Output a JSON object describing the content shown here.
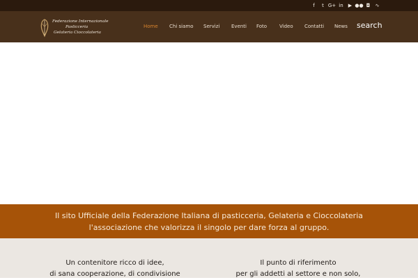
{
  "topbar": {
    "social": [
      {
        "icon": "facebook-icon",
        "glyph": "f"
      },
      {
        "icon": "twitter-icon",
        "glyph": "t"
      },
      {
        "icon": "google-plus-icon",
        "glyph": "G+"
      },
      {
        "icon": "linkedin-icon",
        "glyph": "in"
      },
      {
        "icon": "youtube-icon",
        "glyph": "▶"
      },
      {
        "icon": "flickr-icon",
        "glyph": "●●"
      },
      {
        "icon": "instagram-icon",
        "glyph": "◘"
      },
      {
        "icon": "rss-icon",
        "glyph": "∿"
      }
    ]
  },
  "logo": {
    "line1": "Federazione Internazionale",
    "line2": "Pasticceria",
    "line3": "Gelateria Cioccolateria"
  },
  "nav": {
    "items": [
      {
        "label": "Home"
      },
      {
        "label": "Chi siamo"
      },
      {
        "label": "Servizi"
      },
      {
        "label": "Eventi"
      },
      {
        "label": "Foto"
      },
      {
        "label": "Video"
      },
      {
        "label": "Contatti"
      },
      {
        "label": "News"
      }
    ],
    "search_label": "search"
  },
  "banner": {
    "line1": "Il sito Ufficiale della Federazione Italiana di pasticceria, Gelateria e Cioccolateria",
    "line2": "l'associazione che valorizza il singolo per dare forza al gruppo."
  },
  "features": {
    "left": {
      "line1": "Un contenitore ricco di idee,",
      "line2": "di sana cooperazione, di condivisione"
    },
    "right": {
      "line1": "Il punto di riferimento",
      "line2": "per gli addetti al settore e non solo,"
    }
  },
  "colors": {
    "topbar": "#2b1a0d",
    "header": "#48301b",
    "nav_active": "#d8842e",
    "banner": "#a65308",
    "features_bg": "#ebe7e2"
  }
}
